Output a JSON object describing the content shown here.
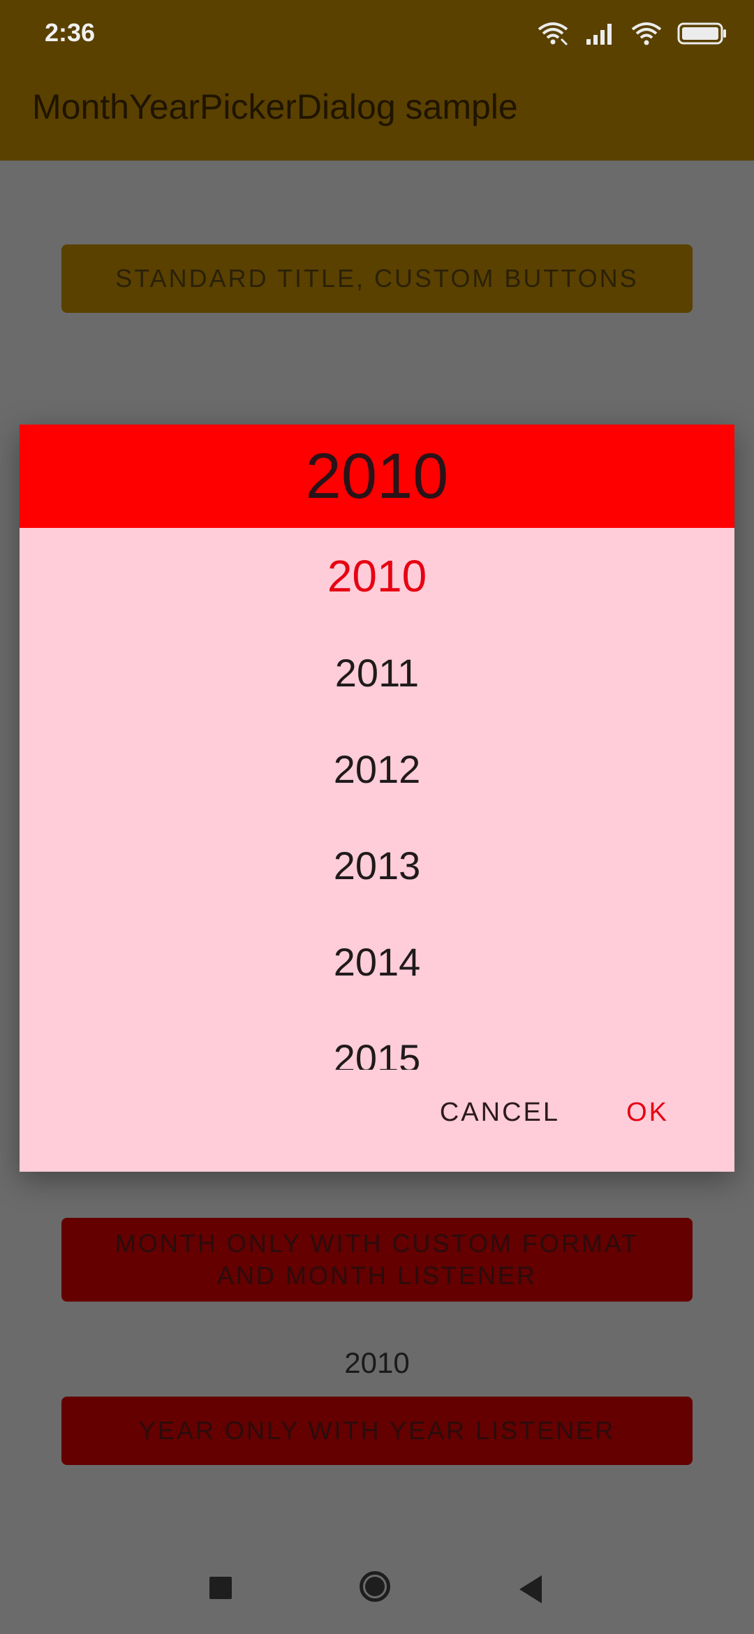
{
  "status_bar": {
    "time": "2:36",
    "icons": [
      "wifi-calling-icon",
      "signal-icon",
      "wifi-icon",
      "battery-icon"
    ]
  },
  "app_bar": {
    "title": "MonthYearPickerDialog sample"
  },
  "buttons": {
    "standard": "STANDARD TITLE, CUSTOM BUTTONS",
    "month_only": "MONTH ONLY WITH CUSTOM FORMAT AND MONTH LISTENER",
    "year_only": "YEAR ONLY WITH YEAR LISTENER"
  },
  "selected_year_text": "2010",
  "dialog": {
    "header_year": "2010",
    "years": [
      "2010",
      "2011",
      "2012",
      "2013",
      "2014",
      "2015"
    ],
    "selected_year": "2010",
    "cancel_label": "CANCEL",
    "ok_label": "OK"
  },
  "colors": {
    "app_bar": "#5a4100",
    "dialog_header": "#ff0000",
    "dialog_body": "#ffccd9",
    "accent": "#e60012",
    "red_button": "#640000",
    "scrim_background": "#6b6b6b"
  },
  "nav_bar": {
    "icons": [
      "recents-square-icon",
      "home-circle-icon",
      "back-triangle-icon"
    ]
  }
}
